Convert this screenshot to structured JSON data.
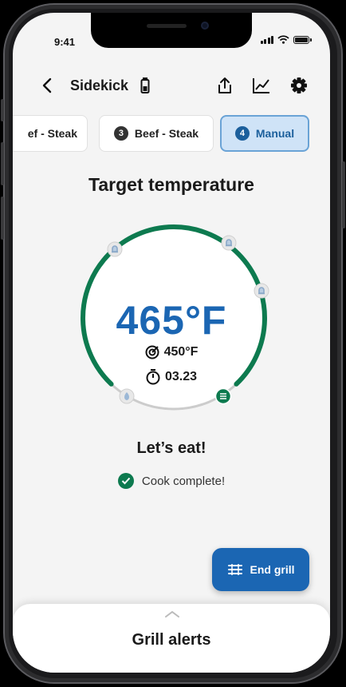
{
  "status_bar": {
    "time": "9:41"
  },
  "header": {
    "title": "Sidekick"
  },
  "tabs": [
    {
      "number": "",
      "label": "ef - Steak"
    },
    {
      "number": "3",
      "label": "Beef - Steak"
    },
    {
      "number": "4",
      "label": "Manual"
    }
  ],
  "main": {
    "target_title": "Target temperature",
    "target_temp": "465°F",
    "current_temp": "450°F",
    "timer": "03.23",
    "status_title": "Let’s eat!",
    "status_message": "Cook complete!"
  },
  "end_grill": {
    "label": "End grill"
  },
  "sheet": {
    "title": "Grill alerts"
  },
  "colors": {
    "accent": "#1b66b3",
    "ring": "#0d7a4f",
    "active_tab_bg": "#cfe3f7",
    "background": "#f4f4f4"
  },
  "icons": [
    "back-arrow-icon",
    "probe-battery-icon",
    "share-icon",
    "chart-icon",
    "gear-icon",
    "bell-icon",
    "flame-icon",
    "grill-icon",
    "probe-target-icon",
    "timer-icon",
    "check-icon",
    "chevron-up-icon"
  ]
}
